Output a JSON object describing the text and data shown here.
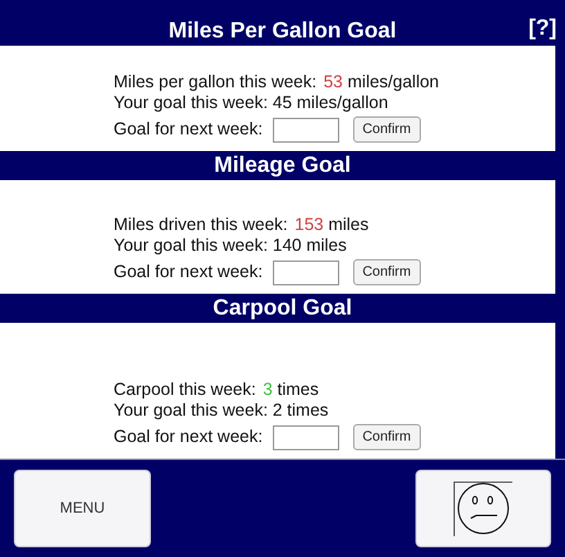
{
  "help": "[?]",
  "goals": [
    {
      "title": "Miles Per Gallon Goal",
      "current_label": "Miles per gallon this week:",
      "current_value": "53",
      "color": "#d04040",
      "current_unit": "miles/gallon",
      "goal_line": "Your goal this week: 45 miles/gallon",
      "next_label": "Goal for next week:",
      "button": "Confirm"
    },
    {
      "title": "Mileage Goal",
      "current_label": "Miles driven this week:",
      "current_value": "153",
      "color": "#d04040",
      "current_unit": "miles",
      "goal_line": "Your goal this week: 140 miles",
      "next_label": "Goal for next week:",
      "button": "Confirm"
    },
    {
      "title": "Carpool Goal",
      "current_label": "Carpool this week:",
      "current_value": "3",
      "color": "#40c040",
      "current_unit": "times",
      "goal_line": "Your goal this week: 2 times",
      "next_label": "Goal for next week:",
      "button": "Confirm"
    }
  ],
  "menu_button": "MENU"
}
